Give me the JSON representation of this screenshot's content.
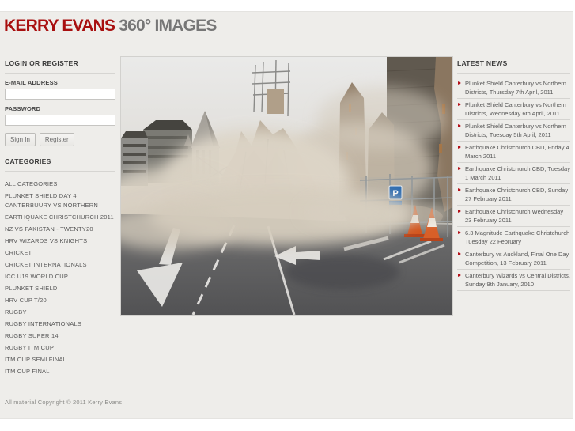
{
  "brand": {
    "name_red": "KERRY EVANS",
    "name_gray": "360° IMAGES"
  },
  "login": {
    "heading": "LOGIN OR REGISTER",
    "email_label": "E-MAIL ADDRESS",
    "email_value": "",
    "password_label": "PASSWORD",
    "password_value": "",
    "sign_in_label": "Sign In",
    "register_label": "Register"
  },
  "categories": {
    "heading": "CATEGORIES",
    "items": [
      "ALL CATEGORIES",
      "PLUNKET SHIELD DAY 4 CANTERBUURY VS NORTHERN",
      "EARTHQUAKE CHRISTCHURCH 2011",
      "NZ VS PAKISTAN - TWENTY20",
      "HRV WIZARDS VS KNIGHTS",
      "CRICKET",
      "CRICKET INTERNATIONALS",
      "ICC U19 WORLD CUP",
      "PLUNKET SHIELD",
      "HRV CUP T/20",
      "RUGBY",
      "RUGBY INTERNATIONALS",
      "RUGBY SUPER 14",
      "RUGBY ITM CUP",
      "ITM CUP SEMI FINAL",
      "ITM CUP FINAL"
    ]
  },
  "news": {
    "heading": "LATEST NEWS",
    "items": [
      "Plunket Shield Canterbury vs Northern Districts, Thursday 7th April, 2011",
      "Plunket Shield Canterbury vs Northern Districts, Wednesday 6th April, 2011",
      "Plunket Shield Canterbury vs Northern Districts, Tuesday 5th April, 2011",
      "Earthquake Christchurch CBD, Friday 4 March 2011",
      "Earthquake Christchurch CBD, Tuesday 1 March 2011",
      "Earthquake Christchurch CBD, Sunday 27 February 2011",
      "Earthquake Christchurch Wednesday 23 February 2011",
      "6.3 Magnitude Earthquake Christchurch Tuesday 22 February",
      "Canterbury vs Auckland, Final One Day Competition, 13 February 2011",
      "Canterbury Wizards vs Central Districts, Sunday 9th January, 2010"
    ]
  },
  "photo": {
    "parking_sign_label": "P"
  },
  "footer": {
    "copyright": "All material Copyright © 2011 Kerry Evans"
  },
  "colors": {
    "accent_red": "#a80f0f",
    "title_gray": "#767676",
    "bullet_red": "#b5121a",
    "page_bg": "#eeedea"
  }
}
